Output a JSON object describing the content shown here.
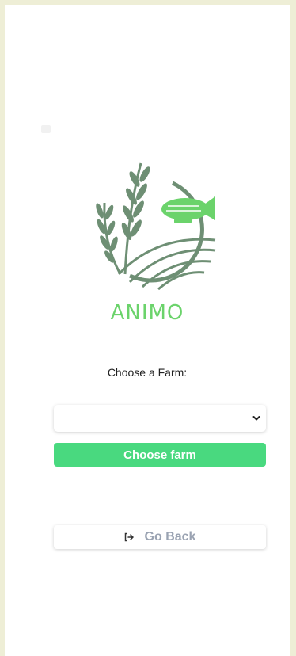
{
  "brand": {
    "name": "ANIMO"
  },
  "farm_picker": {
    "label": "Choose a Farm:",
    "selected_value": "",
    "submit_label": "Choose farm"
  },
  "navigation": {
    "back_label": "Go Back",
    "back_icon": "sign-out-icon"
  },
  "colors": {
    "page_bg": "#eeeed6",
    "brand_green": "#6bd36b",
    "primary_button": "#49d97f",
    "logo_sage": "#6e8f74",
    "back_text": "#9aa3b2"
  }
}
